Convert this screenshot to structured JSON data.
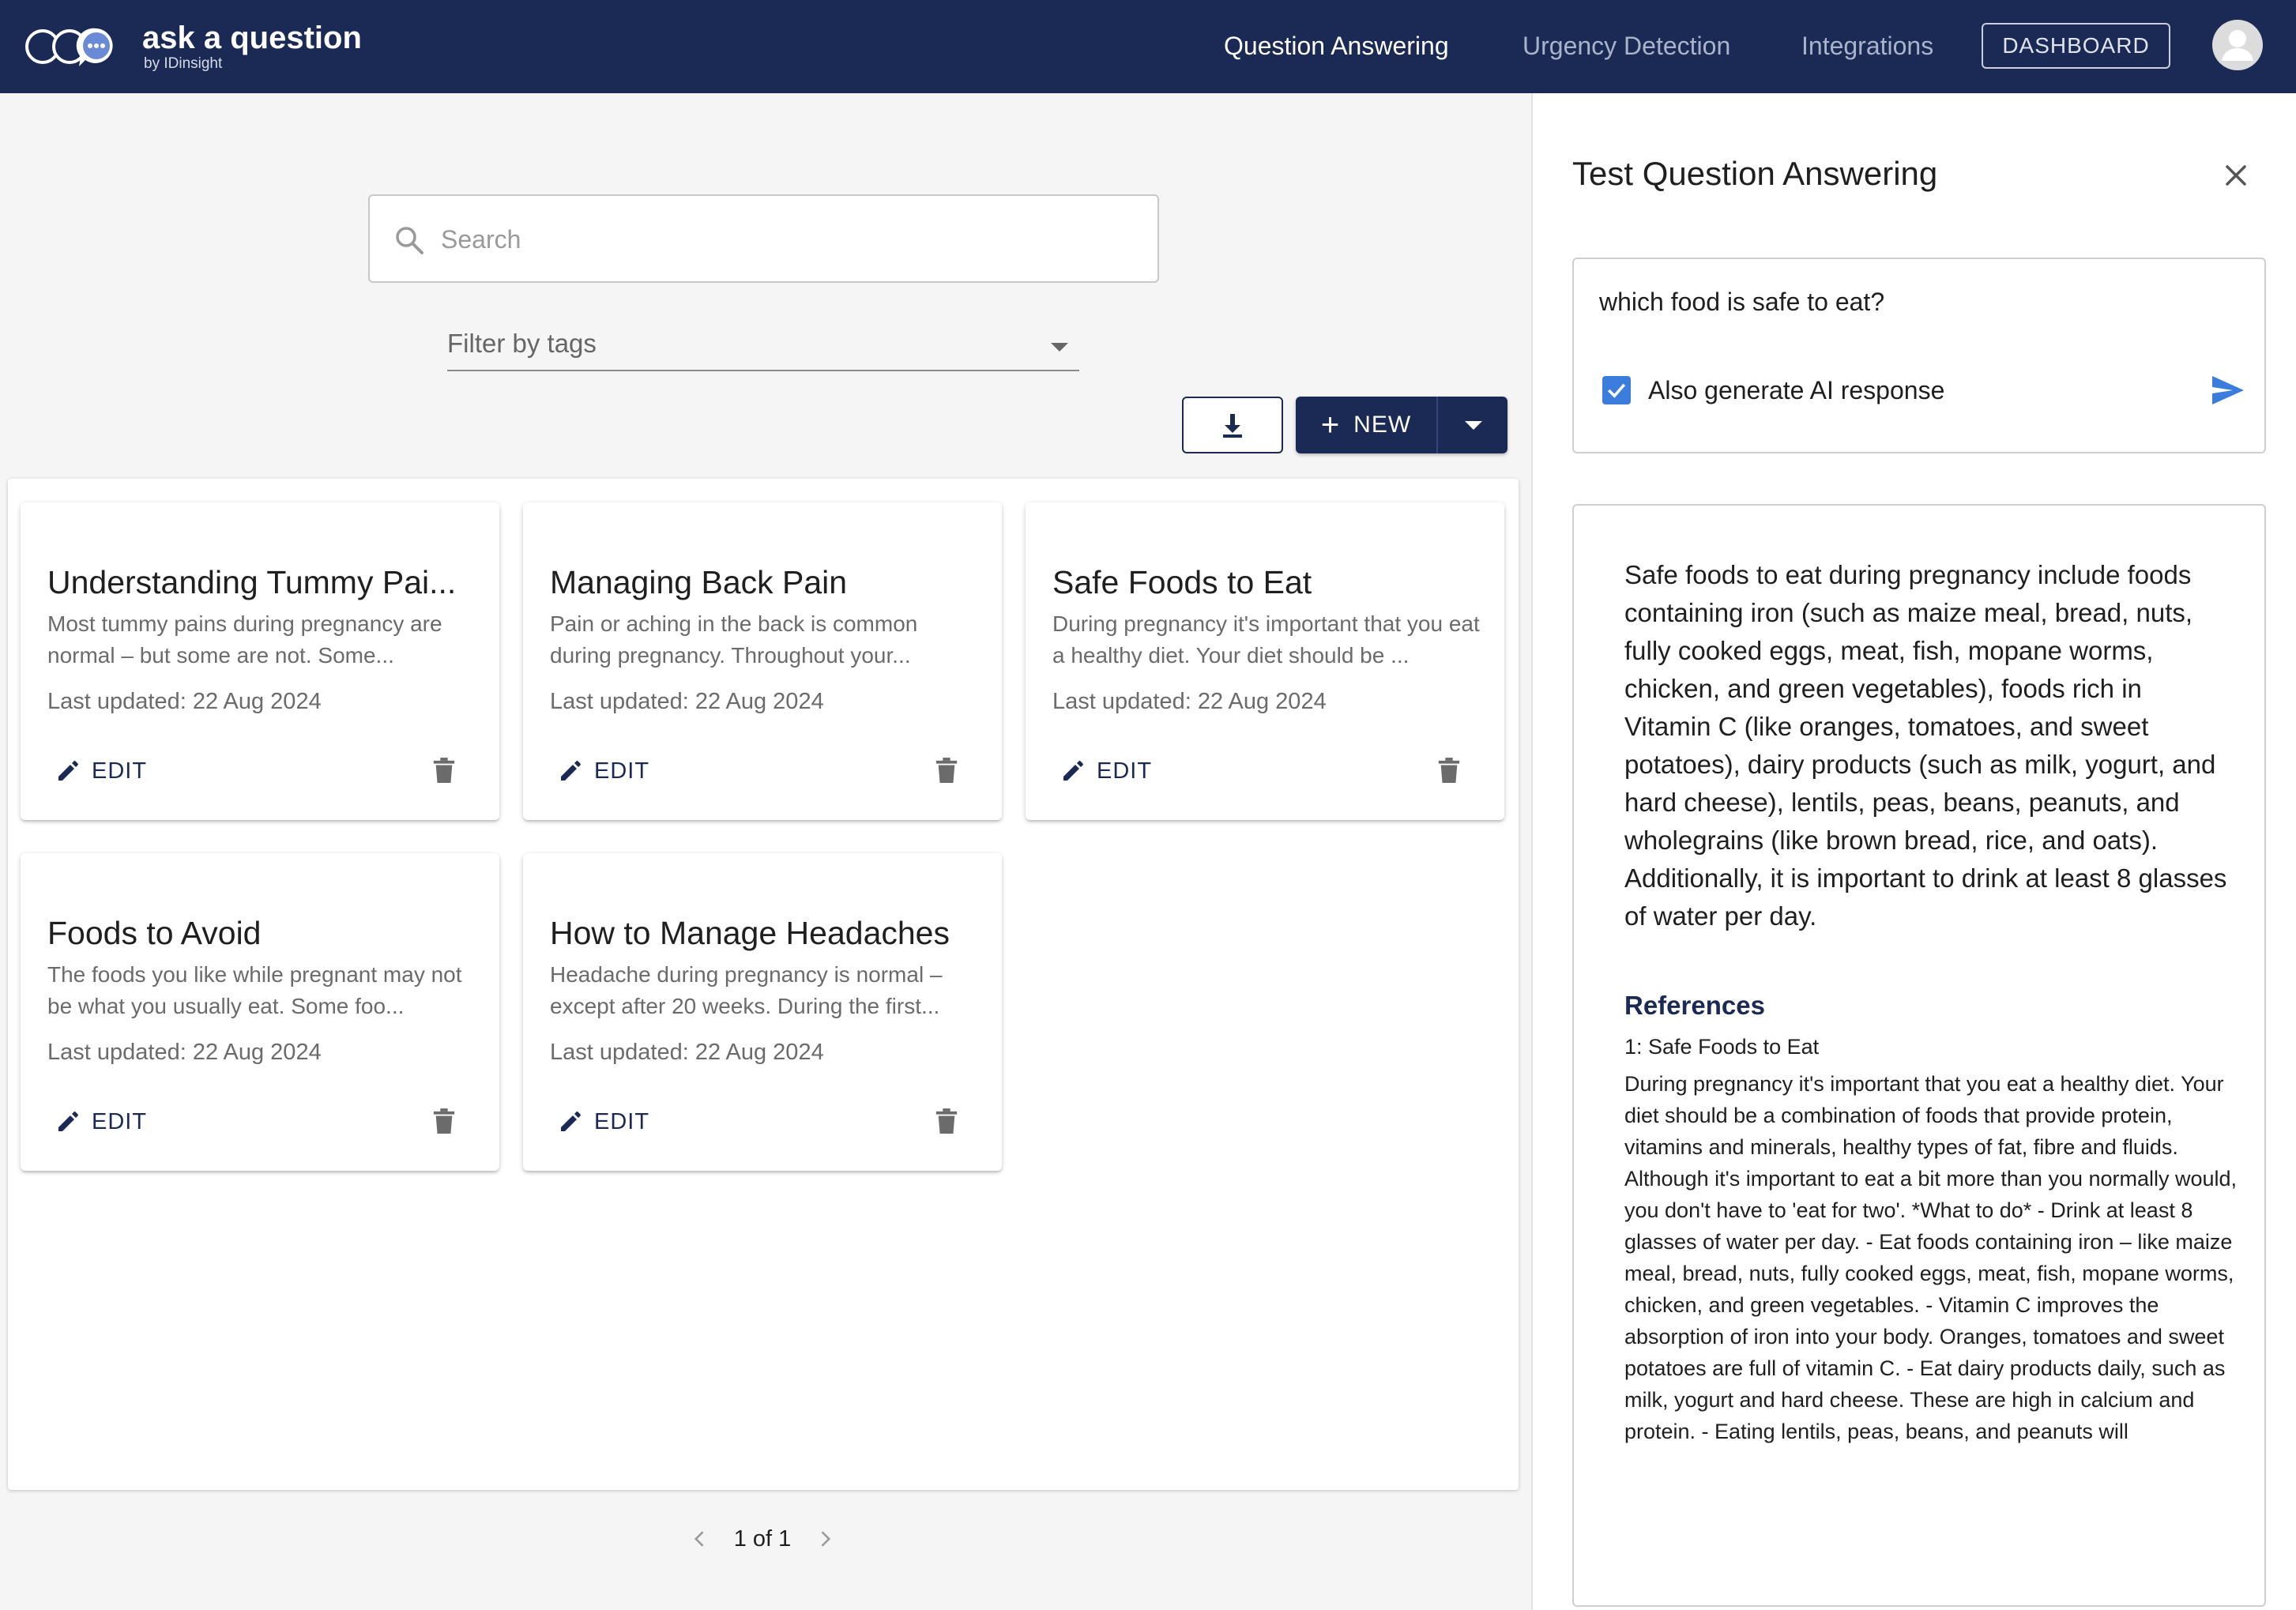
{
  "header": {
    "brand_title": "ask a question",
    "brand_subtitle": "by IDinsight",
    "nav": {
      "question_answering": "Question Answering",
      "urgency_detection": "Urgency Detection",
      "integrations": "Integrations"
    },
    "dashboard_label": "DASHBOARD",
    "colors": {
      "bar": "#1b2a55",
      "active_link": "#ffffff",
      "inactive_link": "#aab3cc"
    }
  },
  "search": {
    "placeholder": "Search",
    "value": ""
  },
  "filter": {
    "label": "Filter by tags"
  },
  "toolbar": {
    "download_icon": "download-icon",
    "new_label": "NEW",
    "new_icon": "plus-icon"
  },
  "cards": [
    {
      "title": "Understanding Tummy Pai...",
      "snippet": "Most tummy pains during pregnancy are normal – but some are not. Some...",
      "updated": "Last updated: 22 Aug 2024",
      "edit_label": "EDIT"
    },
    {
      "title": "Managing Back Pain",
      "snippet": "Pain or aching in the back is common during pregnancy. Throughout your...",
      "updated": "Last updated: 22 Aug 2024",
      "edit_label": "EDIT"
    },
    {
      "title": "Safe Foods to Eat",
      "snippet": "During pregnancy it's important that you eat a healthy diet. Your diet should be ...",
      "updated": "Last updated: 22 Aug 2024",
      "edit_label": "EDIT"
    },
    {
      "title": "Foods to Avoid",
      "snippet": "The foods you like while pregnant may not be what you usually eat. Some foo...",
      "updated": "Last updated: 22 Aug 2024",
      "edit_label": "EDIT"
    },
    {
      "title": "How to Manage Headaches",
      "snippet": "Headache during pregnancy is normal – except after 20 weeks. During the first...",
      "updated": "Last updated: 22 Aug 2024",
      "edit_label": "EDIT"
    }
  ],
  "pagination": {
    "text": "1 of 1"
  },
  "test_panel": {
    "title": "Test Question Answering",
    "query": "which food is safe to eat?",
    "checkbox_label": "Also generate AI response",
    "checkbox_checked": true,
    "answer": "Safe foods to eat during pregnancy include foods containing iron (such as maize meal, bread, nuts, fully cooked eggs, meat, fish, mopane worms, chicken, and green vegetables), foods rich in Vitamin C (like oranges, tomatoes, and sweet potatoes), dairy products (such as milk, yogurt, and hard cheese), lentils, peas, beans, peanuts, and wholegrains (like brown bread, rice, and oats). Additionally, it is important to drink at least 8 glasses of water per day.",
    "references_heading": "References",
    "references": [
      {
        "title": "1: Safe Foods to Eat",
        "body": "During pregnancy it's important that you eat a healthy diet. Your diet should be a combination of foods that provide protein, vitamins and minerals, healthy types of fat, fibre and fluids. Although it's important to eat a bit more than you normally would, you don't have to 'eat for two'. *What to do* - Drink at least 8 glasses of water per day. - Eat foods containing iron – like maize meal, bread, nuts, fully cooked eggs, meat, fish, mopane worms, chicken, and green vegetables. - Vitamin C improves the absorption of iron into your body. Oranges, tomatoes and sweet potatoes are full of vitamin C. - Eat dairy products daily, such as milk, yogurt and hard cheese. These are high in calcium and protein. - Eating lentils, peas, beans, and peanuts will"
      }
    ]
  }
}
